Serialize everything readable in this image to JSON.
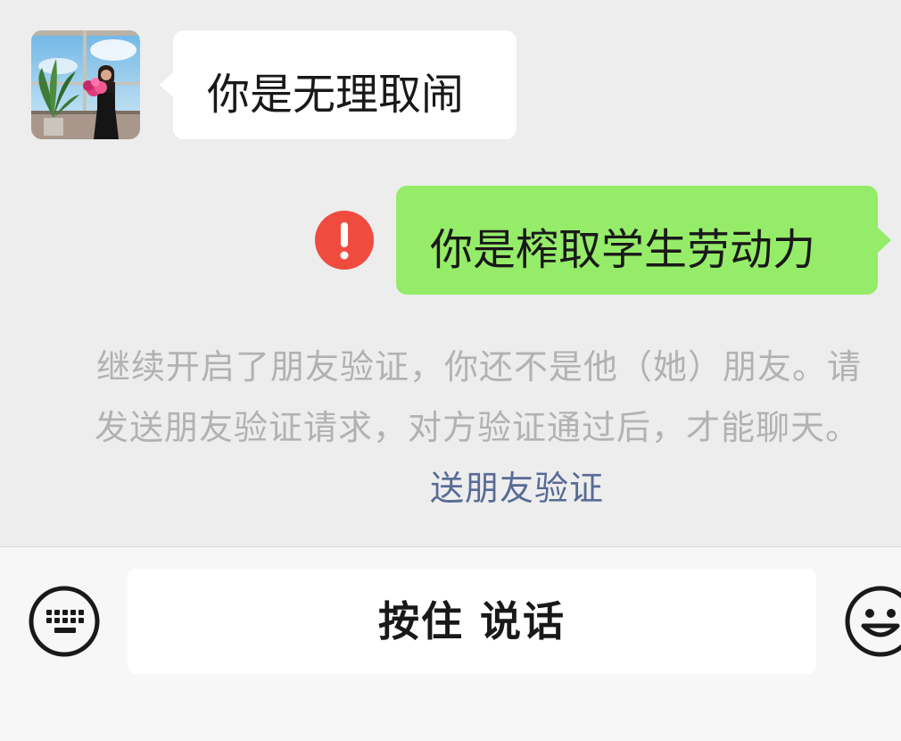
{
  "messages": {
    "incoming_text": "你是无理取闹",
    "outgoing_text": "你是榨取学生劳动力"
  },
  "system_notice": {
    "line1": "继续开启了朋友验证，你还不是他（她）朋友。请",
    "line2": "发送朋友验证请求，对方验证通过后，才能聊天。",
    "link": "送朋友验证"
  },
  "input_bar": {
    "hold_to_talk_label": "按住 说话"
  },
  "colors": {
    "chat_background": "#ededed",
    "incoming_bubble": "#ffffff",
    "outgoing_bubble": "#95ec69",
    "error_red": "#f04b3f",
    "link_blue": "#576b95",
    "system_text": "#b2b2b2"
  },
  "icons": {
    "error": "exclamation-circle-icon",
    "keyboard": "keyboard-icon",
    "emoji": "smiley-icon"
  }
}
